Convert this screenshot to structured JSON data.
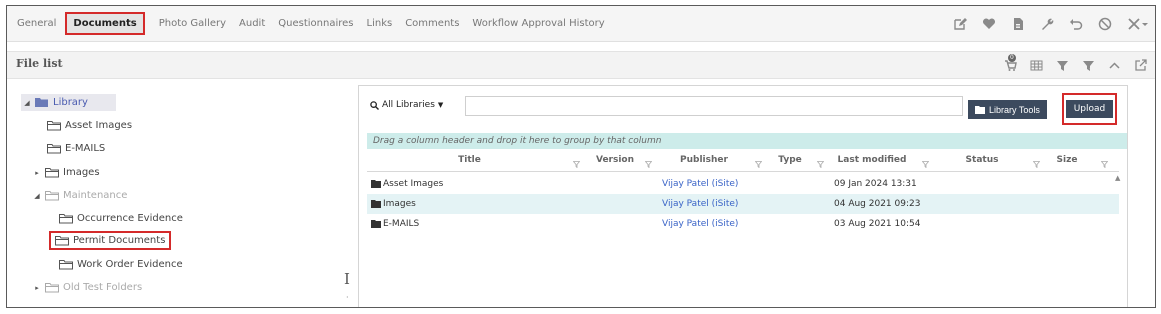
{
  "tabs": [
    {
      "label": "General",
      "active": false
    },
    {
      "label": "Documents",
      "active": true
    },
    {
      "label": "Photo Gallery",
      "active": false
    },
    {
      "label": "Audit",
      "active": false
    },
    {
      "label": "Questionnaires",
      "active": false
    },
    {
      "label": "Links",
      "active": false
    },
    {
      "label": "Comments",
      "active": false
    },
    {
      "label": "Workflow Approval History",
      "active": false
    }
  ],
  "toolbar_icons": [
    "edit-icon",
    "heart-icon",
    "document-icon",
    "wrench-icon",
    "undo-icon",
    "block-icon",
    "tools-dropdown-icon"
  ],
  "file_list": {
    "title": "File list",
    "badge_count": "0",
    "icons": [
      "cart-icon",
      "grid-icon",
      "filter-icon",
      "clear-filter-icon",
      "collapse-icon",
      "popout-icon"
    ]
  },
  "tree": {
    "library": "Library",
    "asset_images": "Asset Images",
    "emails": "E-MAILS",
    "images": "Images",
    "maintenance": "Maintenance",
    "occurrence": "Occurrence Evidence",
    "permit": "Permit Documents",
    "work_order": "Work Order Evidence",
    "old_test": "Old Test Folders"
  },
  "toolbar": {
    "library_selector": "All Libraries",
    "search_value": "",
    "library_tools": "Library Tools",
    "upload": "Upload"
  },
  "grid": {
    "group_hint": "Drag a column header and drop it here to group by that column",
    "columns": [
      "Title",
      "Version",
      "Publisher",
      "Type",
      "Last modified",
      "Status",
      "Size"
    ],
    "rows": [
      {
        "title": "Asset Images",
        "version": "",
        "publisher": "Vijay Patel (iSite)",
        "type": "",
        "modified": "09 Jan 2024 13:31",
        "status": "",
        "size": "",
        "selected": false
      },
      {
        "title": "Images",
        "version": "",
        "publisher": "Vijay Patel (iSite)",
        "type": "",
        "modified": "04 Aug 2021 09:23",
        "status": "",
        "size": "",
        "selected": true
      },
      {
        "title": "E-MAILS",
        "version": "",
        "publisher": "Vijay Patel (iSite)",
        "type": "",
        "modified": "03 Aug 2021 10:54",
        "status": "",
        "size": "",
        "selected": false
      }
    ]
  },
  "colors": {
    "highlight": "#d42a2a",
    "button_dark": "#3c4a5e",
    "group_bar": "#cdecea",
    "link": "#3a64c7"
  }
}
